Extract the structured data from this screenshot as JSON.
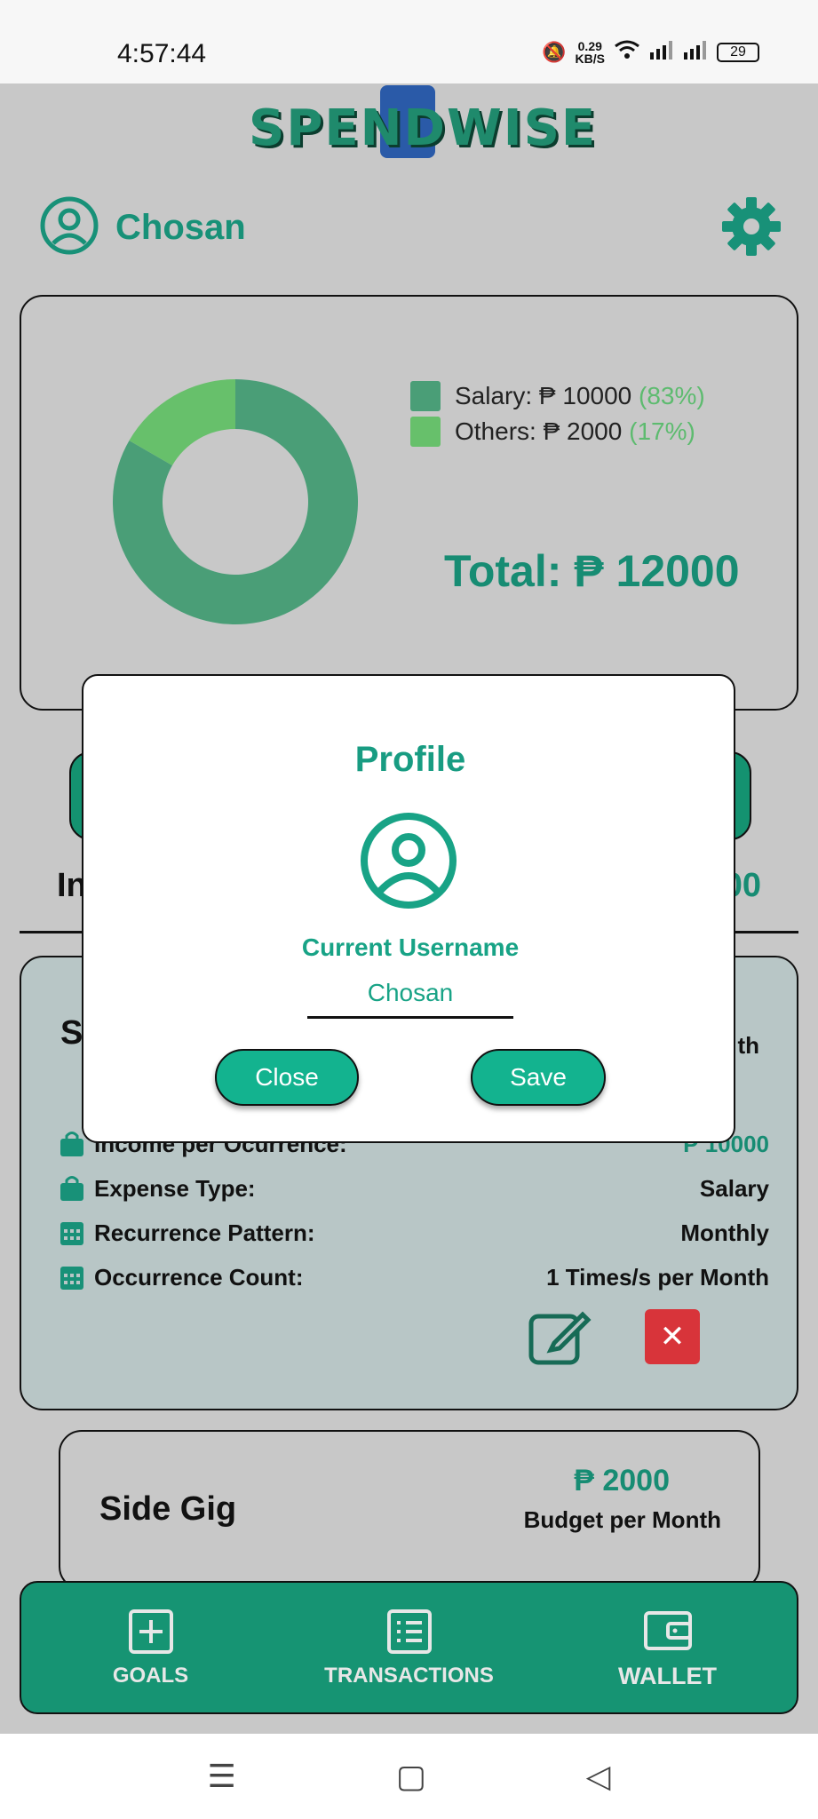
{
  "status": {
    "time": "4:57:44",
    "speed_top": "0.29",
    "speed_bottom": "KB/S",
    "battery": "29"
  },
  "app": {
    "logo_text": "SPENDWISE",
    "username": "Chosan"
  },
  "chart_data": {
    "type": "pie",
    "style": "donut",
    "labels": [
      "Salary",
      "Others"
    ],
    "values": [
      10000,
      2000
    ],
    "percentages": [
      83,
      17
    ],
    "colors": [
      "#4a9e77",
      "#67c06b"
    ],
    "legend_placement": "right"
  },
  "legend": [
    {
      "label": "Salary: ₱ 10000",
      "pct": "(83%)",
      "color": "#4a9e77"
    },
    {
      "label": "Others: ₱ 2000",
      "pct": "(17%)",
      "color": "#67c06b"
    }
  ],
  "total": "Total: ₱ 12000",
  "section": {
    "label_partial": "In",
    "total_partial": "00"
  },
  "income_card": {
    "title_partial": "S",
    "right_partial": "th",
    "details": [
      {
        "icon": "bag-icon",
        "label": "Income per Ocurrence:",
        "value": "₱ 10000"
      },
      {
        "icon": "bag-icon",
        "label": "Expense Type:",
        "value": "Salary"
      },
      {
        "icon": "calendar-icon",
        "label": "Recurrence Pattern:",
        "value": "Monthly"
      },
      {
        "icon": "calendar-icon",
        "label": "Occurrence Count:",
        "value": "1 Times/s per Month"
      }
    ],
    "delete_glyph": "✕"
  },
  "side_gig": {
    "title": "Side Gig",
    "amount": "₱ 2000",
    "subtitle": "Budget per Month"
  },
  "nav": {
    "goals": "GOALS",
    "transactions": "TRANSACTIONS",
    "wallet": "WALLET"
  },
  "sys_nav": {
    "menu": "☰",
    "home": "▢",
    "back": "◁"
  },
  "modal": {
    "title": "Profile",
    "current_label": "Current Username",
    "username_value": "Chosan",
    "close_label": "Close",
    "save_label": "Save"
  },
  "colors": {
    "accent": "#189178",
    "overlay": "#c8c8c8"
  }
}
